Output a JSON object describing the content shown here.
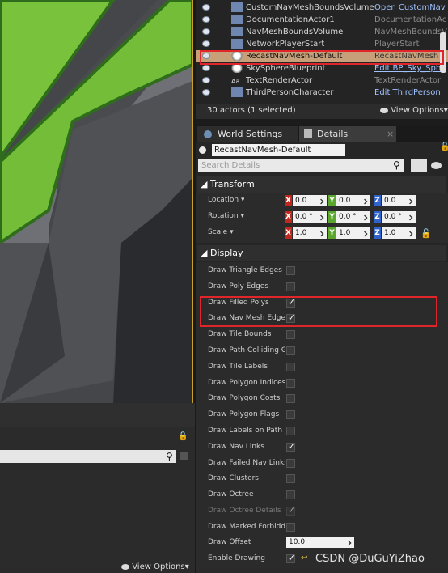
{
  "outliner": {
    "actors": [
      {
        "name": "CustomNavMeshBoundsVolume",
        "cls": "Open CustomNav",
        "link": true,
        "icon": "volume-icon"
      },
      {
        "name": "DocumentationActor1",
        "cls": "DocumentationAc",
        "link": false,
        "icon": "documentation-icon"
      },
      {
        "name": "NavMeshBoundsVolume",
        "cls": "NavMeshBoundsV",
        "link": false,
        "icon": "volume-icon"
      },
      {
        "name": "NetworkPlayerStart",
        "cls": "PlayerStart",
        "link": false,
        "icon": "player-start-icon"
      },
      {
        "name": "RecastNavMesh-Default",
        "cls": "RecastNavMesh",
        "link": false,
        "icon": "sphere-icon"
      },
      {
        "name": "SkySphereBlueprint",
        "cls": "Edit BP_Sky_Sph",
        "link": true,
        "icon": "sphere-icon"
      },
      {
        "name": "TextRenderActor",
        "cls": "TextRenderActor",
        "link": false,
        "icon": "text-render-icon"
      },
      {
        "name": "ThirdPersonCharacter",
        "cls": "Edit ThirdPerson",
        "link": true,
        "icon": "character-icon"
      }
    ],
    "count_text": "30 actors (1 selected)",
    "view_options": "View Options"
  },
  "tabs": {
    "world_settings": "World Settings",
    "details": "Details"
  },
  "details": {
    "actor_name": "RecastNavMesh-Default",
    "search_placeholder": "Search Details",
    "transform": {
      "header": "Transform",
      "location_label": "Location",
      "rotation_label": "Rotation",
      "scale_label": "Scale",
      "axes": [
        "X",
        "Y",
        "Z"
      ],
      "location": [
        "0.0",
        "0.0",
        "0.0"
      ],
      "rotation": [
        "0.0 °",
        "0.0 °",
        "0.0 °"
      ],
      "scale": [
        "1.0",
        "1.0",
        "1.0"
      ]
    },
    "display_header": "Display",
    "display": [
      {
        "label": "Draw Triangle Edges",
        "checked": false,
        "disabled": false
      },
      {
        "label": "Draw Poly Edges",
        "checked": false,
        "disabled": false
      },
      {
        "label": "Draw Filled Polys",
        "checked": true,
        "disabled": false
      },
      {
        "label": "Draw Nav Mesh Edges",
        "checked": true,
        "disabled": false
      },
      {
        "label": "Draw Tile Bounds",
        "checked": false,
        "disabled": false
      },
      {
        "label": "Draw Path Colliding Ge",
        "checked": false,
        "disabled": false
      },
      {
        "label": "Draw Tile Labels",
        "checked": false,
        "disabled": false
      },
      {
        "label": "Draw Polygon Indices",
        "checked": false,
        "disabled": false
      },
      {
        "label": "Draw Polygon Costs",
        "checked": false,
        "disabled": false
      },
      {
        "label": "Draw Polygon Flags",
        "checked": false,
        "disabled": false
      },
      {
        "label": "Draw Labels on Path N",
        "checked": false,
        "disabled": false
      },
      {
        "label": "Draw Nav Links",
        "checked": true,
        "disabled": false
      },
      {
        "label": "Draw Failed Nav Links",
        "checked": false,
        "disabled": false
      },
      {
        "label": "Draw Clusters",
        "checked": false,
        "disabled": false
      },
      {
        "label": "Draw Octree",
        "checked": false,
        "disabled": false
      },
      {
        "label": "Draw Octree Details",
        "checked": true,
        "disabled": true
      },
      {
        "label": "Draw Marked Forbidde",
        "checked": false,
        "disabled": false
      }
    ],
    "draw_offset_label": "Draw Offset",
    "draw_offset_value": "10.0",
    "enable_drawing_label": "Enable Drawing",
    "enable_drawing_checked": true
  },
  "left_panel": {
    "view_options": "View Options"
  },
  "watermark": "CSDN @DuGuYiZhao"
}
